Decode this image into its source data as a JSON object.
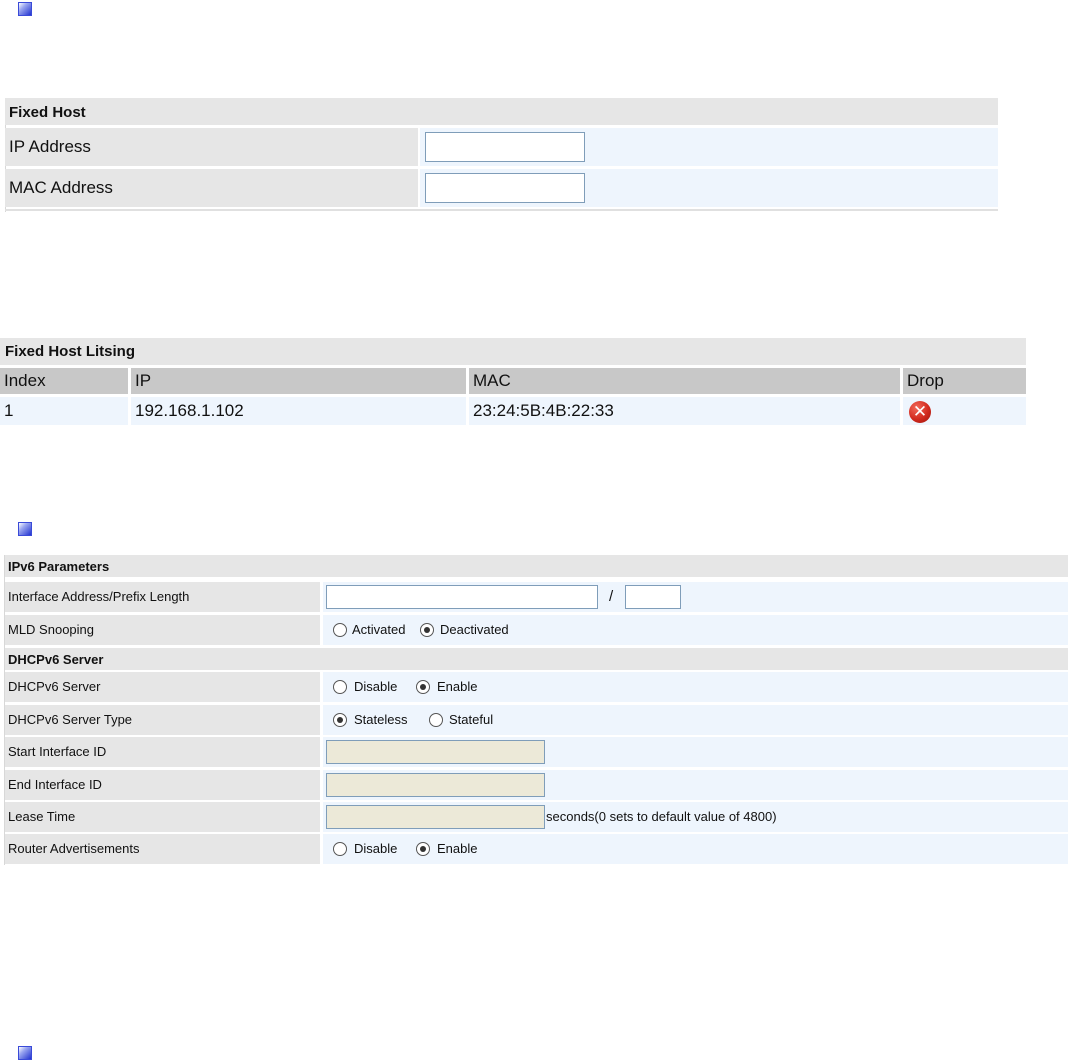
{
  "fixed_host": {
    "title": "Fixed Host",
    "ip_label": "IP Address",
    "ip_value": "",
    "mac_label": "MAC Address",
    "mac_value": ""
  },
  "listing": {
    "title": "Fixed Host Litsing",
    "columns": [
      "Index",
      "IP",
      "MAC",
      "Drop"
    ],
    "rows": [
      {
        "index": "1",
        "ip": "192.168.1.102",
        "mac": "23:24:5B:4B:22:33",
        "drop_icon": "delete-x-icon"
      }
    ]
  },
  "ipv6": {
    "section_title": "IPv6 Parameters",
    "iface_label": "Interface Address/Prefix Length",
    "iface_addr_value": "",
    "slash": "/",
    "prefix_value": "",
    "mld_label": "MLD Snooping",
    "mld_options": [
      "Activated",
      "Deactivated"
    ],
    "mld_selected": "Deactivated",
    "dhcp_section_title": "DHCPv6 Server",
    "dhcp_label": "DHCPv6 Server",
    "dhcp_options": [
      "Disable",
      "Enable"
    ],
    "dhcp_selected": "Enable",
    "type_label": "DHCPv6 Server Type",
    "type_options": [
      "Stateless",
      "Stateful"
    ],
    "type_selected": "Stateless",
    "start_label": "Start Interface ID",
    "end_label": "End Interface ID",
    "lease_label": "Lease Time",
    "lease_hint": "seconds(0 sets to default value of 4800)",
    "ra_label": "Router Advertisements",
    "ra_options": [
      "Disable",
      "Enable"
    ],
    "ra_selected": "Enable"
  },
  "colors": {
    "label_bg": "#e6e6e6",
    "value_bg": "#eef5fd",
    "header_bg": "#c8c8c8",
    "bullet": "#2233d0",
    "drop_icon": "#d22a1e"
  }
}
